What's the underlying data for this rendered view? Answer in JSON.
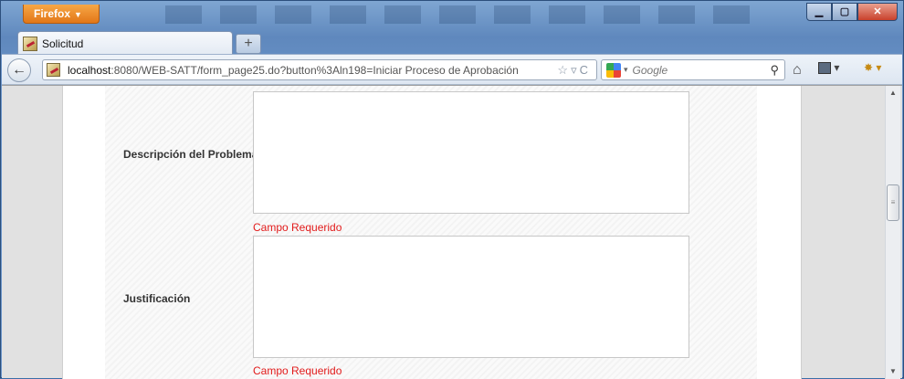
{
  "firefox_menu": {
    "label": "Firefox"
  },
  "window_controls": {
    "minimize": "▁",
    "maximize": "▢",
    "close": "✕"
  },
  "tabs": [
    {
      "title": "Solicitud"
    }
  ],
  "newtab": {
    "symbol": "+"
  },
  "navbar": {
    "url_host": "localhost",
    "url_rest": ":8080/WEB-SATT/form_page25.do?button%3Aln198=Iniciar Proceso de Aprobación",
    "search_placeholder": "Google"
  },
  "form": {
    "fields": [
      {
        "label": "Descripción del Problema",
        "value": "",
        "error": "Campo Requerido"
      },
      {
        "label": "Justificación",
        "value": "",
        "error": "Campo Requerido"
      }
    ]
  },
  "icons": {
    "back": "back-arrow-icon",
    "bookmark_star": "star-icon",
    "reload": "reload-icon",
    "search": "magnifier-icon",
    "home": "home-icon"
  }
}
